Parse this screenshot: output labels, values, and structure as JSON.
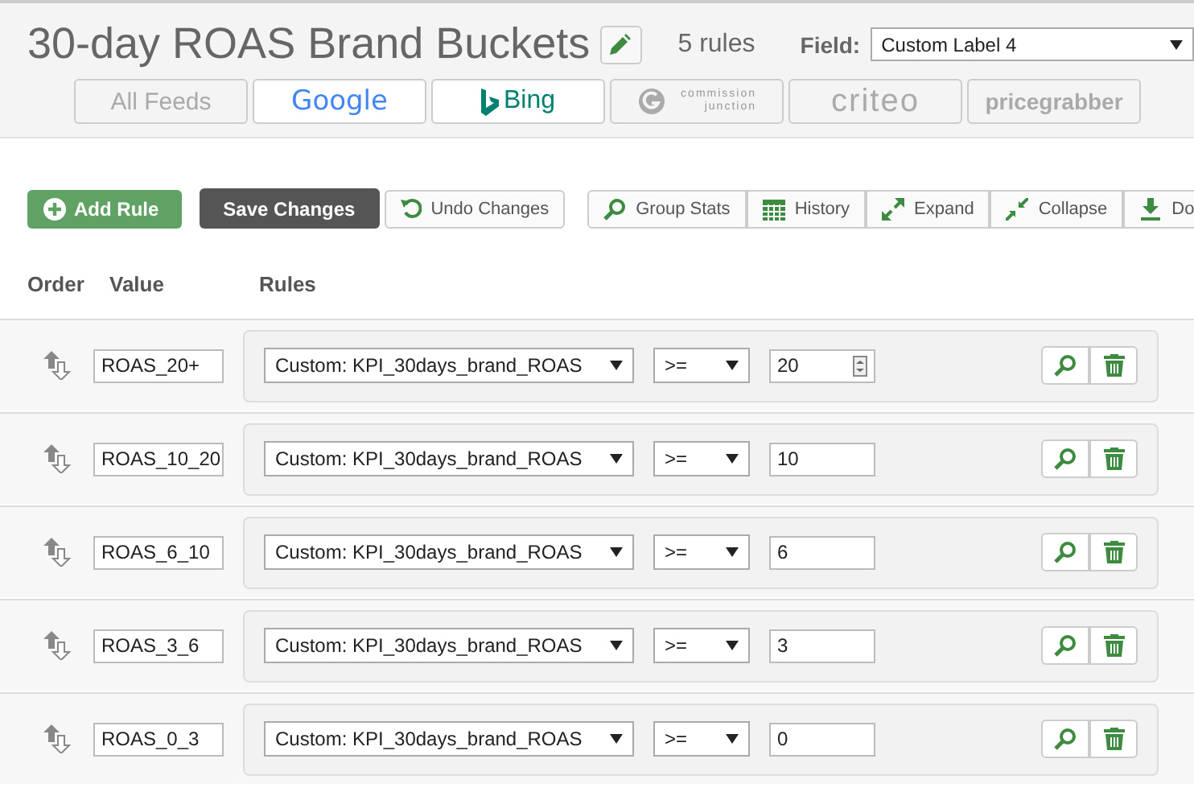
{
  "header": {
    "title": "30-day ROAS Brand Buckets",
    "rule_count": "5 rules",
    "field_label": "Field:",
    "field_value": "Custom Label 4"
  },
  "feeds": [
    {
      "kind": "text",
      "label": "All Feeds",
      "active": false
    },
    {
      "kind": "google",
      "label": "Google",
      "active": true
    },
    {
      "kind": "bing",
      "label": "Bing",
      "active": true
    },
    {
      "kind": "cj",
      "label": "commission junction",
      "active": false
    },
    {
      "kind": "criteo",
      "label": "criteo",
      "active": false
    },
    {
      "kind": "pricegrabber",
      "label": "pricegrabber",
      "active": false
    }
  ],
  "toolbar": {
    "add": "Add Rule",
    "save": "Save Changes",
    "undo": "Undo Changes",
    "tools": [
      {
        "kind": "search",
        "label": "Group Stats"
      },
      {
        "kind": "calendar",
        "label": "History"
      },
      {
        "kind": "expand",
        "label": "Expand"
      },
      {
        "kind": "collapse",
        "label": "Collapse"
      },
      {
        "kind": "download",
        "label": "Do"
      }
    ]
  },
  "columns": [
    "Order",
    "Value",
    "Rules"
  ],
  "rows": [
    {
      "value": "ROAS_20+",
      "attribute": "Custom: KPI_30days_brand_ROAS",
      "operator": ">=",
      "amount": "20",
      "hovered": true
    },
    {
      "value": "ROAS_10_20",
      "attribute": "Custom: KPI_30days_brand_ROAS",
      "operator": ">=",
      "amount": "10",
      "hovered": false
    },
    {
      "value": "ROAS_6_10",
      "attribute": "Custom: KPI_30days_brand_ROAS",
      "operator": ">=",
      "amount": "6",
      "hovered": false
    },
    {
      "value": "ROAS_3_6",
      "attribute": "Custom: KPI_30days_brand_ROAS",
      "operator": ">=",
      "amount": "3",
      "hovered": false
    },
    {
      "value": "ROAS_0_3",
      "attribute": "Custom: KPI_30days_brand_ROAS",
      "operator": ">=",
      "amount": "0",
      "hovered": false
    }
  ]
}
